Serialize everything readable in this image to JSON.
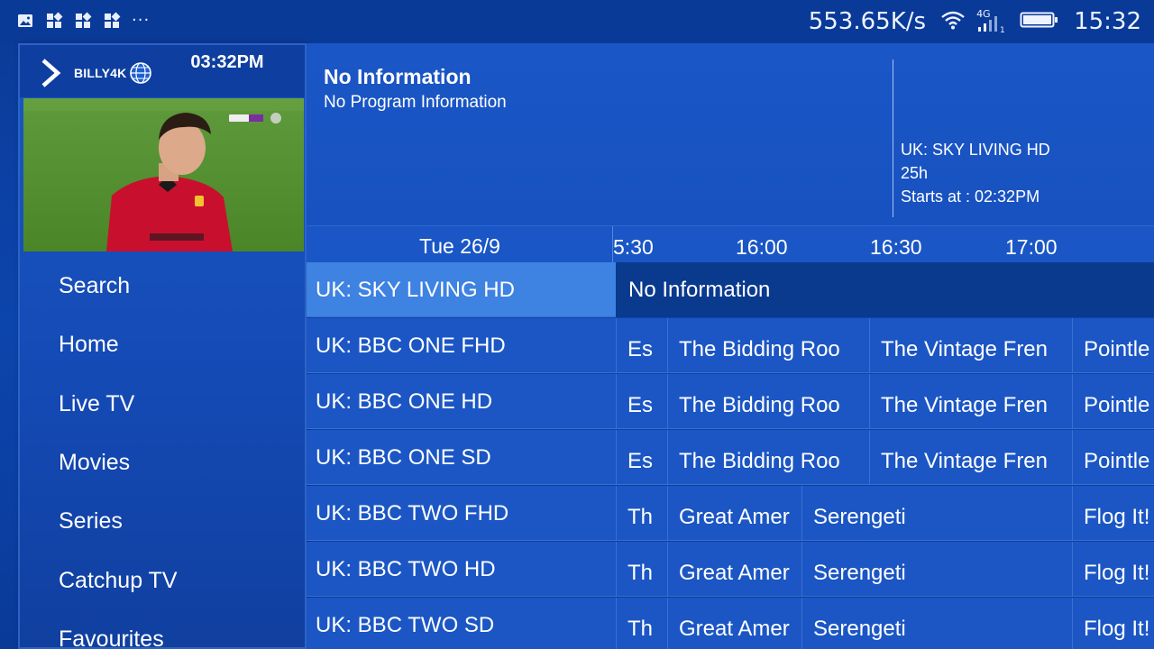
{
  "status_bar": {
    "speed": "553.65K/s",
    "network": "4G",
    "time": "15:32",
    "left_icons": [
      "image-icon",
      "app-grid-icon",
      "app-grid-icon",
      "app-grid-icon"
    ],
    "more": "···"
  },
  "side_panel": {
    "logo_text": "BILLY4K",
    "clock": "03:32PM",
    "menu": [
      {
        "label": "Search"
      },
      {
        "label": "Home"
      },
      {
        "label": "Live TV"
      },
      {
        "label": "Movies"
      },
      {
        "label": "Series"
      },
      {
        "label": "Catchup TV"
      },
      {
        "label": "Favourites"
      }
    ]
  },
  "info": {
    "title": "No Information",
    "subtitle": "No Program Information",
    "channel": "UK: SKY LIVING HD",
    "duration": "25h",
    "starts": "Starts at : 02:32PM"
  },
  "timeline": {
    "date": "Tue 26/9",
    "times": [
      "5:30",
      "16:00",
      "16:30",
      "17:00"
    ]
  },
  "rows": [
    {
      "channel": "UK: SKY LIVING HD",
      "selected": true,
      "full": "No Information"
    },
    {
      "channel": "UK: BBC ONE FHD",
      "programs": [
        "Es",
        "The Bidding Roo",
        "The Vintage Fren",
        "Pointle"
      ]
    },
    {
      "channel": "UK: BBC ONE HD",
      "programs": [
        "Es",
        "The Bidding Roo",
        "The Vintage Fren",
        "Pointle"
      ]
    },
    {
      "channel": "UK: BBC ONE SD",
      "programs": [
        "Es",
        "The Bidding Roo",
        "The Vintage Fren",
        "Pointle"
      ]
    },
    {
      "channel": "UK: BBC TWO FHD",
      "programs": [
        "Th",
        "Great Amer",
        "Serengeti",
        "Flog It!"
      ]
    },
    {
      "channel": "UK: BBC TWO HD",
      "programs": [
        "Th",
        "Great Amer",
        "Serengeti",
        "Flog It!"
      ]
    },
    {
      "channel": "UK: BBC TWO SD",
      "programs": [
        "Th",
        "Great Amer",
        "Serengeti",
        "Flog It!"
      ]
    }
  ],
  "colors": {
    "background": "#0c45ad",
    "panel": "#1a56c6",
    "selected_channel": "#3e82e2",
    "selected_program": "#0a3a8e"
  }
}
